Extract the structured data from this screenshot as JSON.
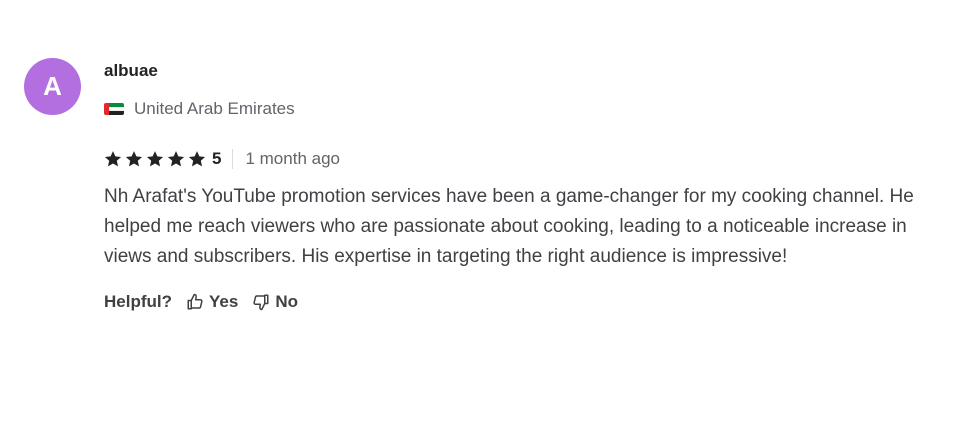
{
  "review": {
    "avatar_letter": "A",
    "avatar_color": "#b36fe0",
    "username": "albuae",
    "country": "United Arab Emirates",
    "country_flag": "uae-flag-icon",
    "rating": 5,
    "rating_label": "5",
    "time_ago": "1 month ago",
    "text": "Nh Arafat's YouTube promotion services have been a game-changer for my cooking channel. He helped me reach viewers who are passionate about cooking, leading to a noticeable increase in views and subscribers. His expertise in targeting the right audience is impressive!"
  },
  "helpful": {
    "label": "Helpful?",
    "yes_label": "Yes",
    "no_label": "No"
  }
}
